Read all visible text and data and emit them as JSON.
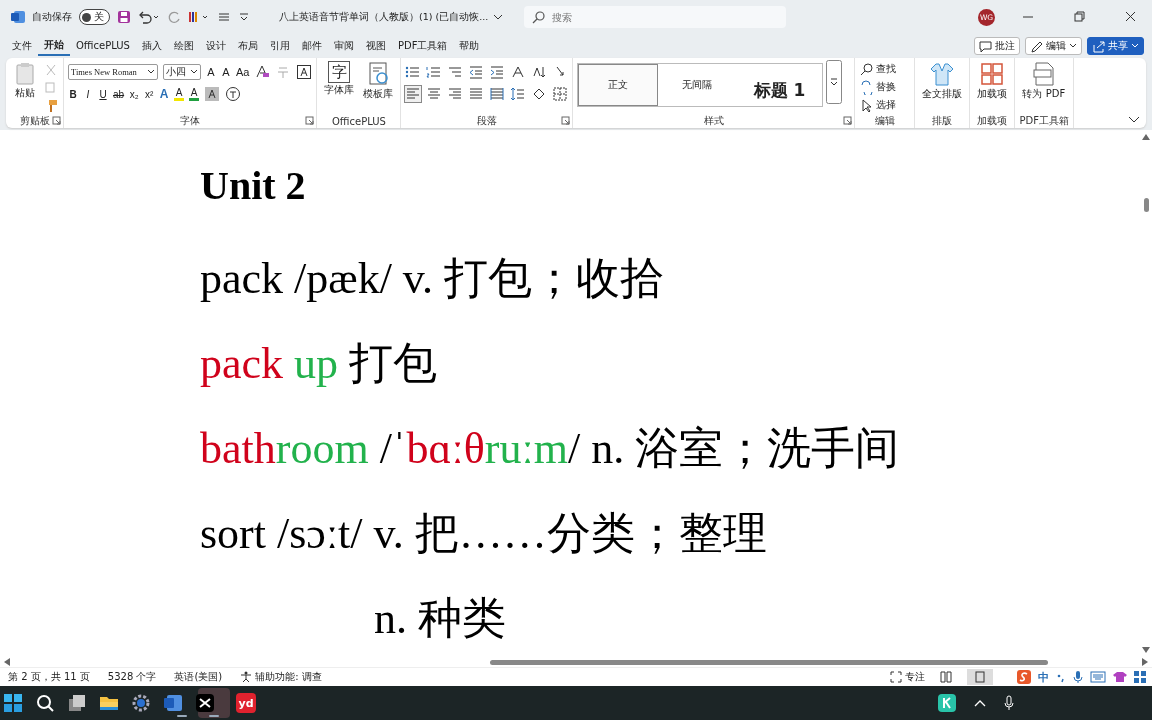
{
  "titlebar": {
    "autosave_label": "自动保存",
    "autosave_toggle": {
      "label": "关",
      "on": false
    },
    "title": "八上英语音节背单词（人教版）(1) (已自动恢...",
    "search": {
      "placeholder": "搜索"
    },
    "avatar": "WG"
  },
  "menu_tabs": [
    {
      "label": "文件",
      "selected": false
    },
    {
      "label": "开始",
      "selected": true
    },
    {
      "label": "OfficePLUS",
      "selected": false
    },
    {
      "label": "插入",
      "selected": false
    },
    {
      "label": "绘图",
      "selected": false
    },
    {
      "label": "设计",
      "selected": false
    },
    {
      "label": "布局",
      "selected": false
    },
    {
      "label": "引用",
      "selected": false
    },
    {
      "label": "邮件",
      "selected": false
    },
    {
      "label": "审阅",
      "selected": false
    },
    {
      "label": "视图",
      "selected": false
    },
    {
      "label": "PDF工具箱",
      "selected": false
    },
    {
      "label": "帮助",
      "selected": false
    }
  ],
  "header_buttons": [
    {
      "label": "批注",
      "kind": "comment"
    },
    {
      "label": "编辑",
      "kind": "edit"
    },
    {
      "label": "共享",
      "kind": "share"
    }
  ],
  "ribbon": {
    "groups": [
      {
        "kind": "clipboard",
        "label": "剪贴板",
        "launcher": true,
        "paste": "粘贴"
      },
      {
        "kind": "font",
        "label": "字体",
        "launcher": true,
        "font_name": "Times New Roman",
        "font_size": "小四",
        "row1": [
          "A",
          "A",
          "Aa"
        ],
        "row2": [
          "B",
          "I",
          "U",
          "ab",
          "x₂",
          "x²",
          "A",
          "A",
          "A"
        ]
      },
      {
        "kind": "big",
        "label": "OfficePLUS",
        "launcher": false,
        "buttons": [
          {
            "label": "字体库",
            "kind": "glyph",
            "glyph": "字"
          },
          {
            "label": "模板库",
            "kind": "template"
          }
        ]
      },
      {
        "kind": "paragraph",
        "label": "段落",
        "launcher": true
      },
      {
        "kind": "styles",
        "label": "样式",
        "launcher": true,
        "styles": [
          {
            "label": "正文",
            "selected": true,
            "kind": "normal"
          },
          {
            "label": "无间隔",
            "selected": false,
            "kind": "normal"
          },
          {
            "label": "标题 1",
            "selected": false,
            "kind": "heading"
          }
        ]
      },
      {
        "kind": "editing",
        "label": "编辑",
        "launcher": false,
        "items": [
          {
            "label": "查找",
            "kind": "find"
          },
          {
            "label": "替换",
            "kind": "replace"
          },
          {
            "label": "选择",
            "kind": "select"
          }
        ]
      },
      {
        "kind": "big",
        "label": "排版",
        "launcher": false,
        "buttons": [
          {
            "label": "全文排版",
            "kind": "shirt"
          }
        ]
      },
      {
        "kind": "big",
        "label": "加载项",
        "launcher": false,
        "buttons": [
          {
            "label": "加载项",
            "kind": "grid"
          }
        ]
      },
      {
        "kind": "big",
        "label": "PDF工具箱",
        "launcher": false,
        "buttons": [
          {
            "label": "转为 PDF",
            "kind": "pdf"
          }
        ]
      }
    ]
  },
  "document": {
    "heading": "Unit 2",
    "lines": [
      {
        "indent": false,
        "segments": [
          {
            "text": "pack /pæk/ v.  打包；收拾",
            "color": "#000000"
          }
        ]
      },
      {
        "indent": false,
        "segments": [
          {
            "text": "pack",
            "color": "#d0021b"
          },
          {
            "text": " up",
            "color": "#22b24c"
          },
          {
            "text": "  打包",
            "color": "#000000"
          }
        ]
      },
      {
        "indent": false,
        "segments": [
          {
            "text": "bath",
            "color": "#d0021b"
          },
          {
            "text": "room",
            "color": "#22b24c"
          },
          {
            "text": " /ˈ",
            "color": "#000000"
          },
          {
            "text": "bɑːθ",
            "color": "#d0021b"
          },
          {
            "text": "ruːm",
            "color": "#22b24c"
          },
          {
            "text": "/ n.  浴室；洗手间",
            "color": "#000000"
          }
        ]
      },
      {
        "indent": false,
        "segments": [
          {
            "text": "sort /sɔːt/ v.  把……分类；整理",
            "color": "#000000"
          }
        ]
      },
      {
        "indent": true,
        "segments": [
          {
            "text": "n.  种类",
            "color": "#000000"
          }
        ]
      }
    ]
  },
  "status_bar": {
    "items": [
      "第 2 页，共 11 页",
      "5328 个字",
      "英语(美国)"
    ],
    "accessibility": "辅助功能: 调查",
    "focus": "专注",
    "ime_mode": "中"
  },
  "taskbar": {
    "apps": [
      {
        "kind": "start",
        "running": false,
        "selected": false
      },
      {
        "kind": "search",
        "running": false,
        "selected": false
      },
      {
        "kind": "taskview",
        "running": false,
        "selected": false
      },
      {
        "kind": "folder",
        "running": false,
        "selected": false
      },
      {
        "kind": "settings",
        "running": false,
        "selected": false
      },
      {
        "kind": "word",
        "running": true,
        "selected": false
      },
      {
        "kind": "capcut",
        "running": true,
        "selected": true
      },
      {
        "kind": "dict",
        "text": "yd",
        "running": false,
        "selected": false
      }
    ]
  }
}
